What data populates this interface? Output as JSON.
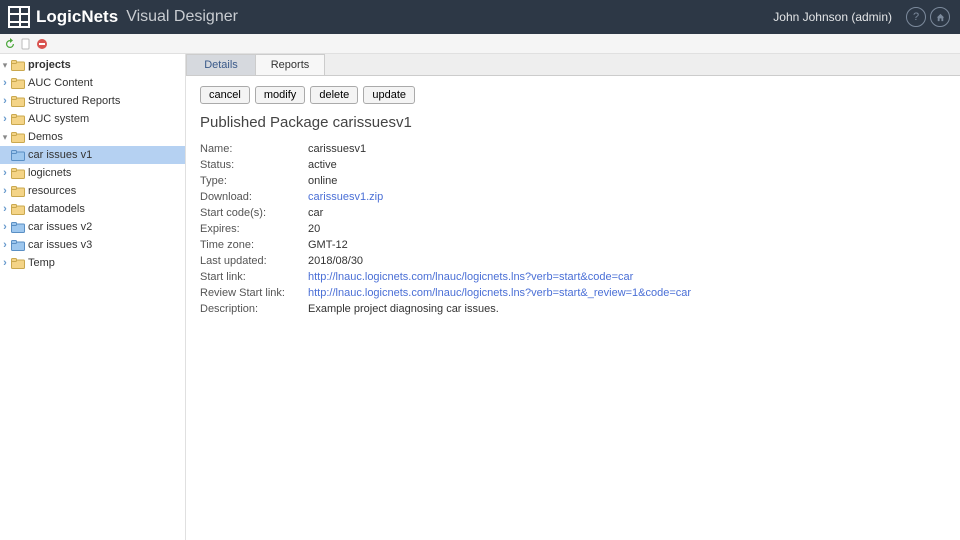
{
  "header": {
    "brand": "LogicNets",
    "product": "Visual Designer",
    "user": "John Johnson (admin)"
  },
  "tree": {
    "root": "projects",
    "items": [
      {
        "depth": 1,
        "arrow": "right",
        "folder": "closed",
        "label": "AUC Content"
      },
      {
        "depth": 1,
        "arrow": "right",
        "folder": "closed",
        "label": "Structured Reports"
      },
      {
        "depth": 1,
        "arrow": "right",
        "folder": "closed",
        "label": "AUC system"
      },
      {
        "depth": 1,
        "arrow": "down",
        "folder": "open",
        "label": "Demos"
      },
      {
        "depth": 2,
        "arrow": "none",
        "folder": "blue",
        "label": "car issues v1",
        "selected": true
      },
      {
        "depth": 3,
        "arrow": "right",
        "folder": "closed",
        "label": "logicnets"
      },
      {
        "depth": 3,
        "arrow": "right",
        "folder": "closed",
        "label": "resources"
      },
      {
        "depth": 3,
        "arrow": "right",
        "folder": "closed",
        "label": "datamodels"
      },
      {
        "depth": 2,
        "arrow": "right",
        "folder": "blue",
        "label": "car issues v2"
      },
      {
        "depth": 2,
        "arrow": "right",
        "folder": "blue",
        "label": "car issues v3"
      },
      {
        "depth": 1,
        "arrow": "right",
        "folder": "closed",
        "label": "Temp"
      }
    ]
  },
  "tabs": [
    "Details",
    "Reports"
  ],
  "active_tab": 0,
  "buttons": {
    "cancel": "cancel",
    "modify": "modify",
    "delete": "delete",
    "update": "update"
  },
  "page": {
    "title": "Published Package carissuesv1",
    "rows": [
      {
        "key": "Name:",
        "value": "carissuesv1",
        "link": false
      },
      {
        "key": "Status:",
        "value": "active",
        "link": false
      },
      {
        "key": "Type:",
        "value": "online",
        "link": false
      },
      {
        "key": "Download:",
        "value": "carissuesv1.zip",
        "link": true
      },
      {
        "key": "Start code(s):",
        "value": "car",
        "link": false
      },
      {
        "key": "Expires:",
        "value": "20",
        "link": false
      },
      {
        "key": "Time zone:",
        "value": "GMT-12",
        "link": false
      },
      {
        "key": "Last updated:",
        "value": "2018/08/30",
        "link": false
      },
      {
        "key": "Start link:",
        "value": "http://lnauc.logicnets.com/lnauc/logicnets.lns?verb=start&code=car",
        "link": true
      },
      {
        "key": "Review Start link:",
        "value": "http://lnauc.logicnets.com/lnauc/logicnets.lns?verb=start&_review=1&code=car",
        "link": true
      },
      {
        "key": "Description:",
        "value": "Example project diagnosing car issues.",
        "link": false
      }
    ]
  }
}
